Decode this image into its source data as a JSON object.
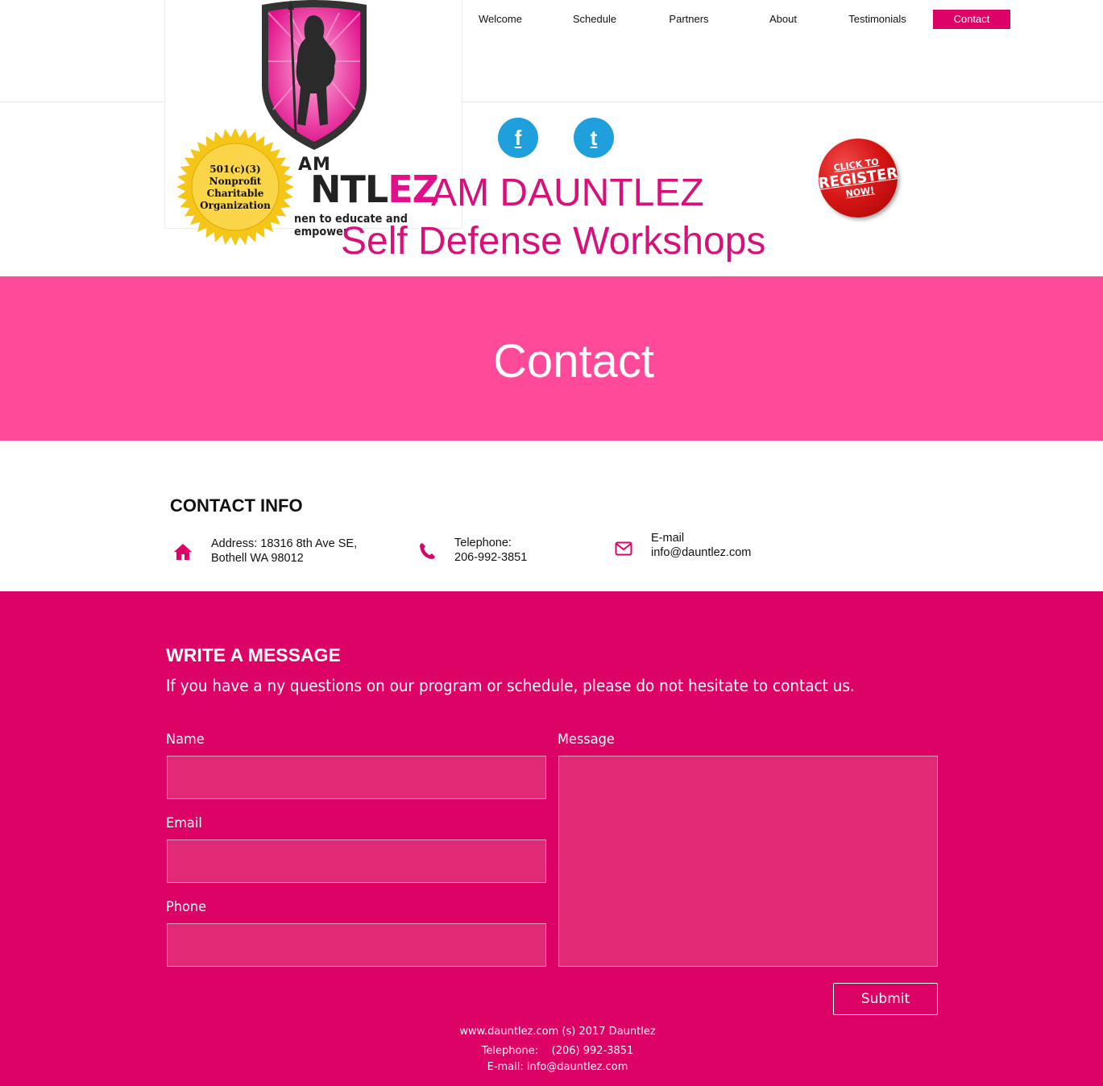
{
  "nav": {
    "items": [
      {
        "label": "Welcome"
      },
      {
        "label": "Schedule"
      },
      {
        "label": "Partners"
      },
      {
        "label": "About"
      },
      {
        "label": "Testimonials"
      },
      {
        "label": "Contact",
        "active": true
      }
    ]
  },
  "logo": {
    "am": "AM",
    "ntl": "NTL",
    "ez": "EZ",
    "tagline": "nen to educate and empower"
  },
  "seal": {
    "line1": "501(c)(3)",
    "line2": "Nonprofit",
    "line3": "Charitable",
    "line4": "Organization"
  },
  "social": {
    "facebook": "f",
    "twitter": "t"
  },
  "header": {
    "title": "AM DAUNTLEZ",
    "subtitle": "Self Defense Workshops"
  },
  "register": {
    "line1": "CLICK TO",
    "line2": "REGISTER",
    "line3": "NOW!"
  },
  "banner": {
    "title": "Contact"
  },
  "contact_info": {
    "title": "CONTACT INFO",
    "address_line1": "Address: 18316 8th Ave SE,",
    "address_line2": "Bothell WA 98012",
    "phone_label": "Telephone:",
    "phone_value": "206-992-3851",
    "email_label": "E-mail",
    "email_value": "info@dauntlez.com"
  },
  "message": {
    "title": "WRITE A MESSAGE",
    "subtitle": "If you have a ny questions on our program or schedule, please do not hesitate to contact us.",
    "name_label": "Name",
    "email_label": "Email",
    "phone_label": "Phone",
    "message_label": "Message",
    "submit_label": "Submit"
  },
  "footer": {
    "line1": "www.dauntlez.com (s) 2017 Dauntlez",
    "line2": "Telephone:    (206) 992-3851",
    "line3": "E-mail: info@dauntlez.com"
  },
  "colors": {
    "brand_pink": "#dd0266",
    "banner_pink": "#ff4a99",
    "title_pink": "#d6127a",
    "social_blue": "#1fa0dd",
    "register_red": "#d81616"
  }
}
